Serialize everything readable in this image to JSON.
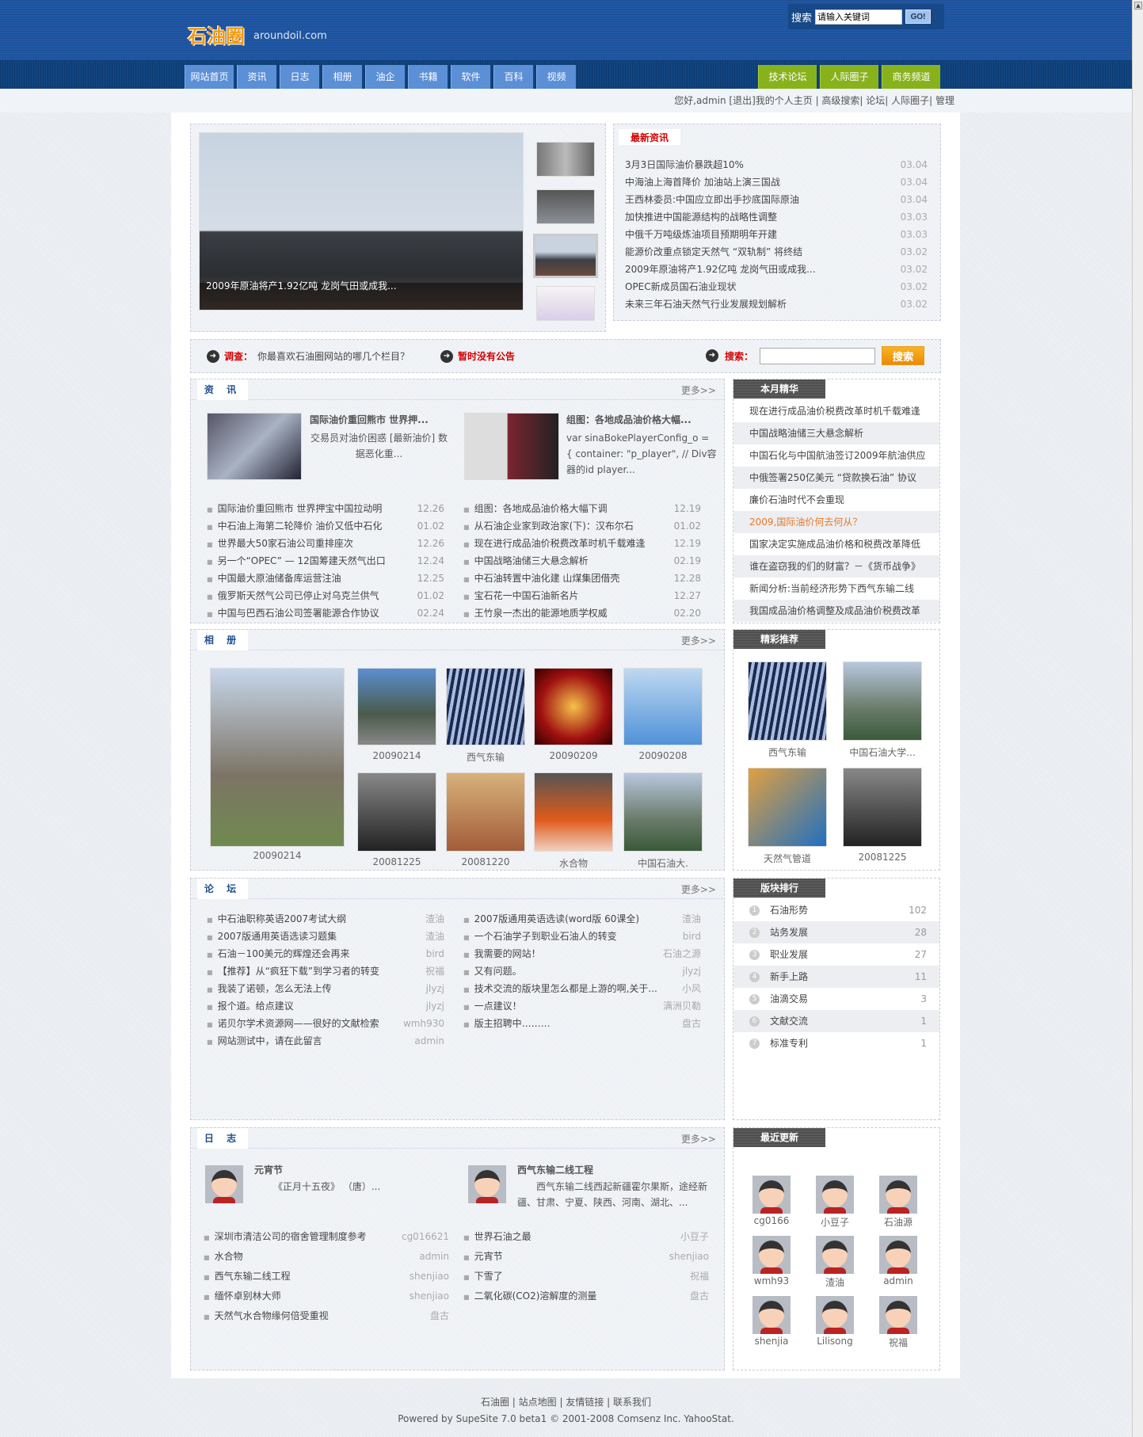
{
  "header": {
    "logo": "石油圈",
    "domain": "aroundoil.com",
    "search_label": "搜索",
    "search_placeholder": "请输入关键词",
    "go": "GO!"
  },
  "nav": {
    "left": [
      "网站首页",
      "资讯",
      "日志",
      "相册",
      "油企",
      "书籍",
      "软件",
      "百科",
      "视频"
    ],
    "right": [
      "技术论坛",
      "人际圈子",
      "商务频道"
    ]
  },
  "userbar": "您好,admin [退出]我的个人主页 | 高级搜索| 论坛| 人际圈子| 管理",
  "slideshow": {
    "caption": "2009年原油将产1.92亿吨 龙岗气田或成我..."
  },
  "latest": {
    "title": "最新资讯",
    "items": [
      [
        "3月3日国际油价暴跌超10%",
        "03.04"
      ],
      [
        "中海油上海首降价 加油站上演三国战",
        "03.04"
      ],
      [
        "王西林委员:中国应立即出手抄底国际原油",
        "03.04"
      ],
      [
        "加快推进中国能源结构的战略性调整",
        "03.03"
      ],
      [
        "中俄千万吨级炼油项目预期明年开建",
        "03.03"
      ],
      [
        "能源价改重点锁定天然气 “双轨制” 将终结",
        "03.02"
      ],
      [
        "2009年原油将产1.92亿吨 龙岗气田或成我...",
        "03.02"
      ],
      [
        "OPEC新成员国石油业现状",
        "03.02"
      ],
      [
        "未来三年石油天然气行业发展规划解析",
        "03.02"
      ]
    ]
  },
  "notice": {
    "survey_label": "调查：",
    "survey_text": "你最喜欢石油圈网站的哪几个栏目？",
    "announce": "暂时没有公告",
    "search_label": "搜索：",
    "search_button": "搜索"
  },
  "more": "更多>>",
  "news": {
    "title": "资 讯",
    "feature": [
      {
        "title": "国际油价重回熊市 世界押...",
        "desc": "交易员对油价困惑 [最新油价] 数据恶化重..."
      },
      {
        "title": "组图：各地成品油价格大幅...",
        "desc": "var sinaBokePlayerConfig_o = { container: \"p_player\", // Div容器的id player..."
      }
    ],
    "left": [
      [
        "国际油价重回熊市 世界押宝中国拉动明",
        "12.26"
      ],
      [
        "中石油上海第二轮降价 油价又低中石化",
        "01.02"
      ],
      [
        "世界最大50家石油公司重排座次",
        "12.26"
      ],
      [
        "另一个“OPEC” — 12国筹建天然气出口",
        "12.24"
      ],
      [
        "中国最大原油储备库运营注油",
        "12.25"
      ],
      [
        "俄罗斯天然气公司已停止对乌克兰供气",
        "01.02"
      ],
      [
        "中国与巴西石油公司签署能源合作协议",
        "02.24"
      ]
    ],
    "right": [
      [
        "组图：各地成品油价格大幅下调",
        "12.19"
      ],
      [
        "从石油企业家到政治家(下)：汉布尔石",
        "01.02"
      ],
      [
        "现在进行成品油价税费改革时机千载难逢",
        "12.19"
      ],
      [
        "中国战略油储三大悬念解析",
        "02.19"
      ],
      [
        "中石油转置中油化建 山煤集团借壳",
        "12.28"
      ],
      [
        "宝石花一中国石油新名片",
        "12.27"
      ],
      [
        "王竹泉一杰出的能源地质学权威",
        "02.20"
      ]
    ]
  },
  "monthly": {
    "title": "本月精华",
    "items": [
      "现在进行成品油价税费改革时机千载难逢",
      "中国战略油储三大悬念解析",
      "中国石化与中国航油签订2009年航油供应",
      "中俄签署250亿美元 “贷款换石油” 协议",
      "廉价石油时代不会重现",
      "2009,国际油价何去何从？",
      "国家决定实施成品油价格和税费改革降低",
      "谁在盗窃我的们的财富？－《货币战争》",
      "新闻分析:当前经济形势下西气东输二线",
      "我国成品油价格调整及成品油价税费改革"
    ],
    "highlight_color": "#e8782a"
  },
  "album": {
    "title": "相 册",
    "big": "20090214",
    "row1": [
      "20090214",
      "西气东输",
      "20090209",
      "20090208"
    ],
    "row2": [
      "20081225",
      "20081220",
      "水合物",
      "中国石油大."
    ]
  },
  "recommend": {
    "title": "精彩推荐",
    "items": [
      "西气东输",
      "中国石油大学...",
      "天然气管道",
      "20081225"
    ]
  },
  "forum": {
    "title": "论 坛",
    "left": [
      [
        "中石油职称英语2007考试大纲",
        "渣油"
      ],
      [
        "2007版通用英语选读习题集",
        "渣油"
      ],
      [
        "石油－100美元的辉煌还会再来",
        "bird"
      ],
      [
        "【推荐】从“疯狂下载”到学习者的转变",
        "祝福"
      ],
      [
        "我装了诺顿，怎么无法上传",
        "jlyzj"
      ],
      [
        "报个道。给点建议",
        "jlyzj"
      ],
      [
        "诺贝尔学术资源网——很好的文献检索",
        "wmh930"
      ],
      [
        "网站测试中，请在此留言",
        "admin"
      ]
    ],
    "right": [
      [
        "2007版通用英语选读(word版 60课全)",
        "渣油"
      ],
      [
        "一个石油学子到职业石油人的转变",
        "bird"
      ],
      [
        "我需要的网站！",
        "石油之源"
      ],
      [
        "又有问题。",
        "jlyzj"
      ],
      [
        "技术交流的版块里怎么都是上游的啊,关于...",
        "小风"
      ],
      [
        "一点建议！",
        "满洲贝勒"
      ],
      [
        "版主招聘中………",
        "盘古"
      ]
    ]
  },
  "ranking": {
    "title": "版块排行",
    "items": [
      [
        "1",
        "石油形势",
        "102"
      ],
      [
        "2",
        "站务发展",
        "28"
      ],
      [
        "3",
        "职业发展",
        "27"
      ],
      [
        "4",
        "新手上路",
        "11"
      ],
      [
        "5",
        "油滴交易",
        "3"
      ],
      [
        "6",
        "文献交流",
        "1"
      ],
      [
        "7",
        "标准专利",
        "1"
      ]
    ]
  },
  "blog": {
    "title": "日 志",
    "feature": [
      {
        "title": "元宵节",
        "desc": "《正月十五夜》 （唐）..."
      },
      {
        "title": "西气东输二线工程",
        "desc": "西气东输二线西起新疆霍尔果斯，途经新疆、甘肃、宁夏、陕西、河南、湖北、..."
      }
    ],
    "left": [
      [
        "深圳市清洁公司的宿舍管理制度参考",
        "cg016621"
      ],
      [
        "水合物",
        "admin"
      ],
      [
        "西气东输二线工程",
        "shenjiao"
      ],
      [
        "缅怀卓别林大师",
        "shenjiao"
      ],
      [
        "天然气水合物缘何倍受重视",
        "盘古"
      ]
    ],
    "right": [
      [
        "世界石油之最",
        "小豆子"
      ],
      [
        "元宵节",
        "shenjiao"
      ],
      [
        "下雪了",
        "祝福"
      ],
      [
        "二氧化碳(CO2)溶解度的测量",
        "盘古"
      ]
    ]
  },
  "recent": {
    "title": "最近更新",
    "users": [
      "cg0166",
      "小豆子",
      "石油源",
      "wmh93",
      "渣油",
      "admin",
      "shenjia",
      "Lilisong",
      "祝福"
    ]
  },
  "footer": {
    "links": "石油圈 | 站点地图 | 友情链接 | 联系我们",
    "powered": "Powered by SupeSite 7.0 beta1 © 2001-2008 Comsenz Inc. YahooStat."
  },
  "colors": {
    "header": "#1f55a0",
    "nav_tab": "#5b8fd6",
    "nav_green": "#88b21c",
    "accent_red": "#d40000"
  }
}
